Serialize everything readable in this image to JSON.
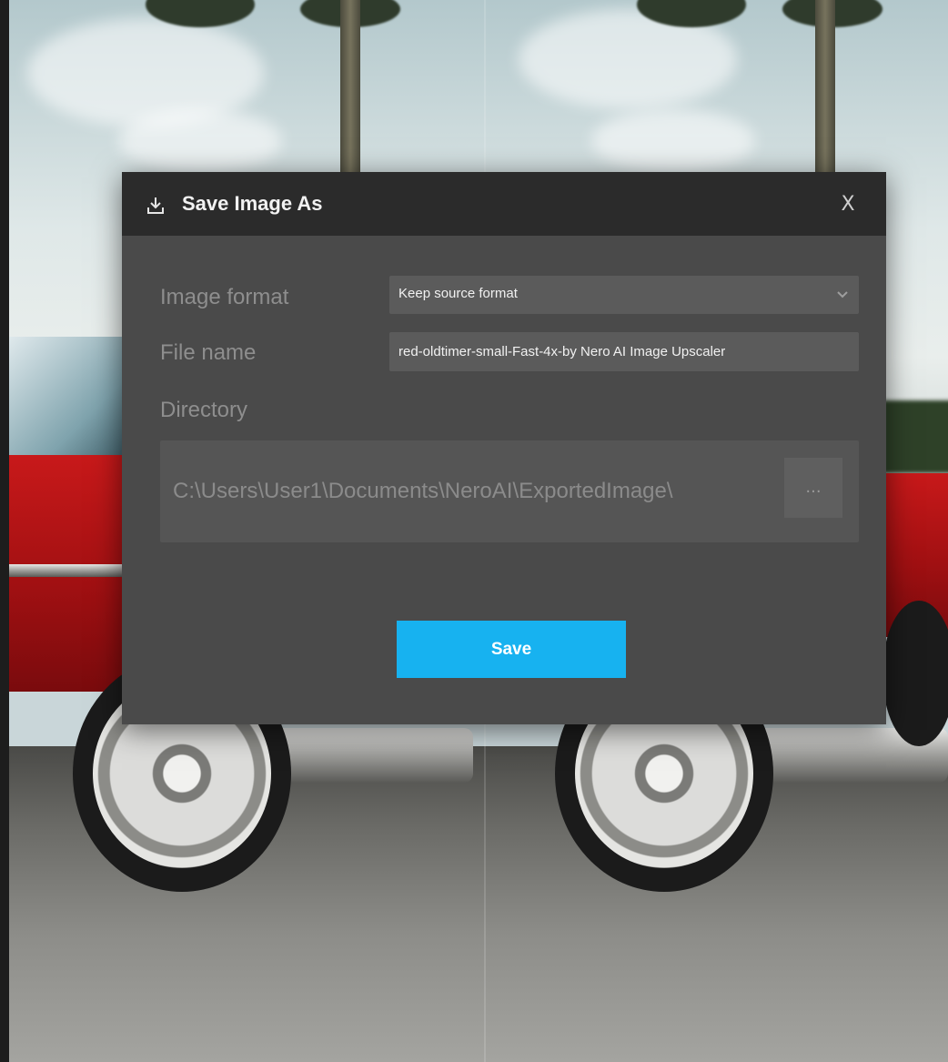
{
  "dialog": {
    "title": "Save Image As",
    "title_icon": "download-icon",
    "close_label": "X",
    "save_label": "Save"
  },
  "fields": {
    "image_format": {
      "label": "Image format",
      "value": "Keep source format",
      "icon": "chevron-down-icon"
    },
    "file_name": {
      "label": "File name",
      "value": "red-oldtimer-small-Fast-4x-by Nero AI Image Upscaler"
    },
    "directory": {
      "label": "Directory",
      "path": "C:\\Users\\User1\\Documents\\NeroAI\\ExportedImage\\",
      "browse_label": "..."
    }
  },
  "colors": {
    "accent": "#17b2f0",
    "dialog_bg": "#4a4a4a",
    "header_bg": "#2b2b2b"
  }
}
